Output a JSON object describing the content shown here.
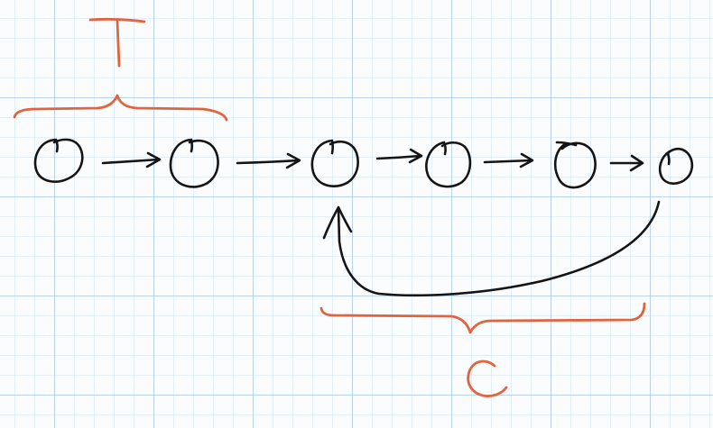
{
  "labels": {
    "tail": "T",
    "cycle": "C"
  },
  "colors": {
    "ink": "#141414",
    "accent": "#e0643f",
    "grid": "#96bee1"
  },
  "nodes_count": 6
}
